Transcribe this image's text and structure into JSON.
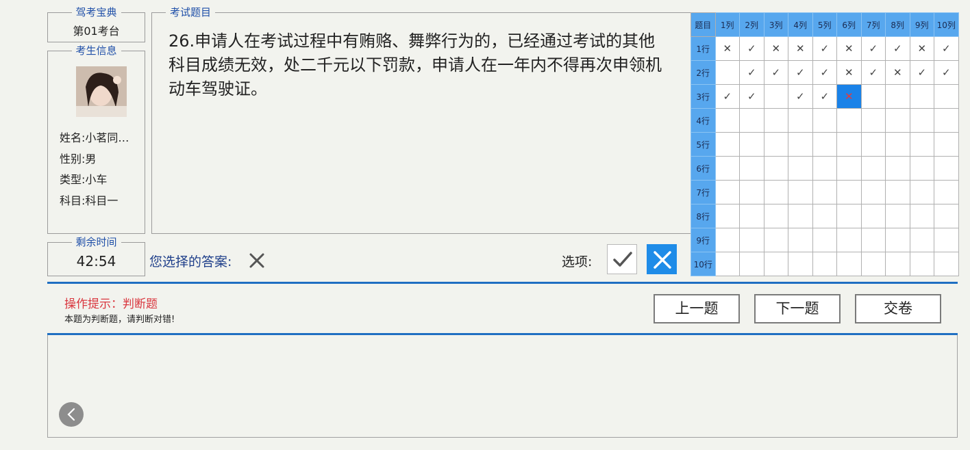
{
  "station": {
    "legend": "驾考宝典",
    "value": "第01考台"
  },
  "candidate": {
    "legend": "考生信息",
    "name": "姓名:小茗同…",
    "gender": "性别:男",
    "type": "类型:小车",
    "subject": "科目:科目一"
  },
  "timer": {
    "legend": "剩余时间",
    "value": "42:54"
  },
  "question": {
    "legend": "考试题目",
    "text": "26.申请人在考试过程中有贿赂、舞弊行为的，已经通过考试的其他科目成绩无效，处二千元以下罚款，申请人在一年内不得再次申领机动车驾驶证。"
  },
  "answer": {
    "label": "您选择的答案:",
    "selected": "wrong"
  },
  "options": {
    "label": "选项:"
  },
  "grid": {
    "corner": "题目",
    "columns": [
      "1列",
      "2列",
      "3列",
      "4列",
      "5列",
      "6列",
      "7列",
      "8列",
      "9列",
      "10列"
    ],
    "rows": [
      "1行",
      "2行",
      "3行",
      "4行",
      "5行",
      "6行",
      "7行",
      "8行",
      "9行",
      "10行"
    ],
    "cells": [
      [
        "✕",
        "✓",
        "✕",
        "✕",
        "✓",
        "✕",
        "✓",
        "✓",
        "✕",
        "✓"
      ],
      [
        "",
        "✓",
        "✓",
        "✓",
        "✓",
        "✕",
        "✓",
        "✕",
        "✓",
        "✓"
      ],
      [
        "✓",
        "✓",
        "",
        "✓",
        "✓",
        "✕",
        "",
        "",
        "",
        ""
      ],
      [
        "",
        "",
        "",
        "",
        "",
        "",
        "",
        "",
        "",
        ""
      ],
      [
        "",
        "",
        "",
        "",
        "",
        "",
        "",
        "",
        "",
        ""
      ],
      [
        "",
        "",
        "",
        "",
        "",
        "",
        "",
        "",
        "",
        ""
      ],
      [
        "",
        "",
        "",
        "",
        "",
        "",
        "",
        "",
        "",
        ""
      ],
      [
        "",
        "",
        "",
        "",
        "",
        "",
        "",
        "",
        "",
        ""
      ],
      [
        "",
        "",
        "",
        "",
        "",
        "",
        "",
        "",
        "",
        ""
      ],
      [
        "",
        "",
        "",
        "",
        "",
        "",
        "",
        "",
        "",
        ""
      ]
    ],
    "current": {
      "row": 3,
      "col": 6
    }
  },
  "tip": {
    "title": "操作提示：判断题",
    "body": "本题为判断题，请判断对错!"
  },
  "buttons": {
    "prev": "上一题",
    "next": "下一题",
    "submit": "交卷"
  },
  "icons": {
    "back": "chevron-left-icon",
    "check": "check-icon",
    "cross": "cross-icon"
  },
  "colors": {
    "accent": "#1f8ce8",
    "header": "#57a7ee",
    "tip": "#d9363e",
    "legend": "#1f4fa8"
  }
}
